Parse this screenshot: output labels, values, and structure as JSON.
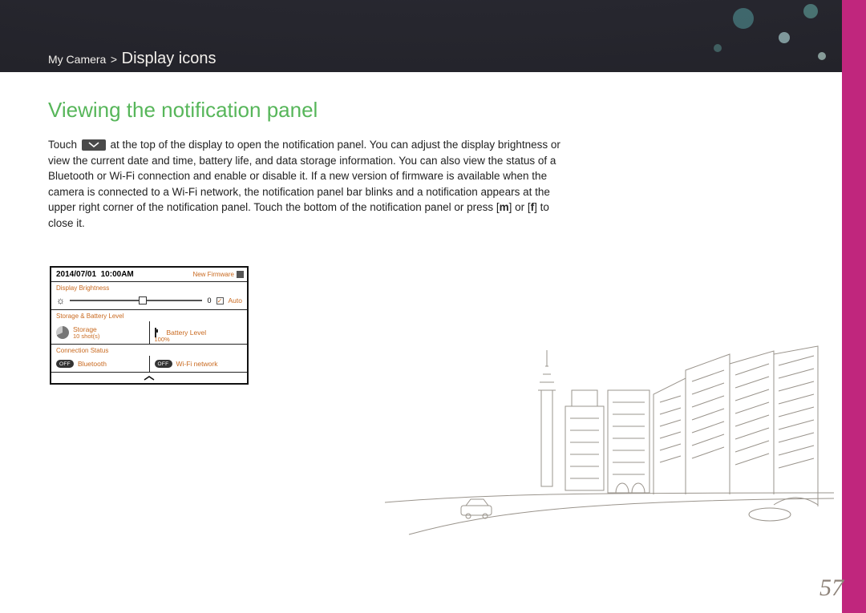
{
  "breadcrumb": {
    "section": "My Camera",
    "sep": ">",
    "page": "Display icons"
  },
  "heading": "Viewing the notification panel",
  "body": {
    "pre": "Touch ",
    "post": " at the top of the display to open the notification panel. You can adjust the display brightness or view the current date and time, battery life, and data storage information. You can also view the status of a Bluetooth or Wi-Fi connection and enable or disable it. If a new version of firmware is available when the camera is connected to a Wi-Fi network, the notification panel bar blinks and a notification appears at the upper right corner of the notification panel. Touch the bottom of the notification panel or press [",
    "key1": "m",
    "mid": "] or [",
    "key2": "f",
    "end": "] to close it."
  },
  "panel": {
    "date": "2014/07/01",
    "time": "10:00AM",
    "new_firmware": "New Firmware",
    "sect_brightness": "Display Brightness",
    "brightness_value": "0",
    "auto_label": "Auto",
    "sect_storage": "Storage & Battery Level",
    "storage_label": "Storage",
    "storage_sub": "10 shot(s)",
    "battery_label": "Battery Level",
    "battery_pct": "100%",
    "sect_connection": "Connection Status",
    "bt_state": "OFF",
    "bt_label": "Bluetooth",
    "wifi_state": "OFF",
    "wifi_label": "Wi-Fi network"
  },
  "page_number": "57"
}
